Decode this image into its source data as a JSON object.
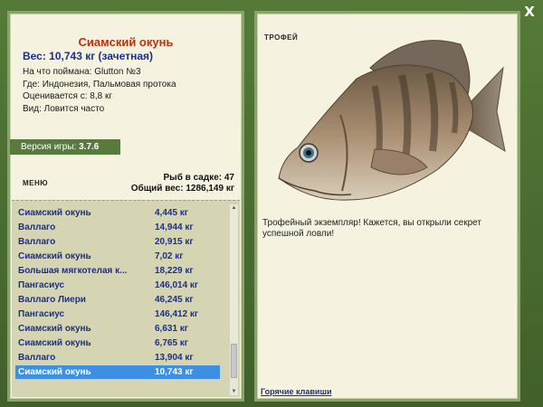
{
  "close_symbol": "X",
  "catch": {
    "name": "Сиамский окунь",
    "weight_line": "Вес: 10,743 кг (зачетная)",
    "details": [
      "На что поймана: Glutton №3",
      "Где: Индонезия, Пальмовая протока",
      "Оценивается с: 8,8 кг",
      "Вид: Ловится часто"
    ]
  },
  "version": {
    "label": "Версия игры:",
    "value": "3.7.6"
  },
  "menu_label": "МЕНЮ",
  "stats": {
    "fish_count": "Рыб в садке: 47",
    "total_weight": "Общий вес: 1286,149 кг"
  },
  "fish_list": [
    {
      "name": "Сиамский окунь",
      "weight": "4,445 кг"
    },
    {
      "name": "Валлаго",
      "weight": "14,944 кг"
    },
    {
      "name": "Валлаго",
      "weight": "20,915 кг"
    },
    {
      "name": "Сиамский окунь",
      "weight": "7,02 кг"
    },
    {
      "name": "Большая мягкотелая к...",
      "weight": "18,229 кг"
    },
    {
      "name": "Пангасиус",
      "weight": "146,014 кг"
    },
    {
      "name": "Валлаго Лиери",
      "weight": "46,245 кг"
    },
    {
      "name": "Пангасиус",
      "weight": "146,412 кг"
    },
    {
      "name": "Сиамский окунь",
      "weight": "6,631 кг"
    },
    {
      "name": "Сиамский окунь",
      "weight": "6,765 кг"
    },
    {
      "name": "Валлаго",
      "weight": "13,904 кг"
    },
    {
      "name": "Сиамский окунь",
      "weight": "10,743 кг",
      "selected": true
    }
  ],
  "trophy": {
    "label": "ТРОФЕЙ",
    "description": "Трофейный экземпляр! Кажется, вы открыли секрет успешной ловли!"
  },
  "hotkeys_link": "Горячие клавиши",
  "colors": {
    "frame": "#4d6b32",
    "panel": "#f5f3df",
    "selection": "#3c8fe3",
    "list_text": "#1b2f8a",
    "title": "#c02e0a"
  }
}
